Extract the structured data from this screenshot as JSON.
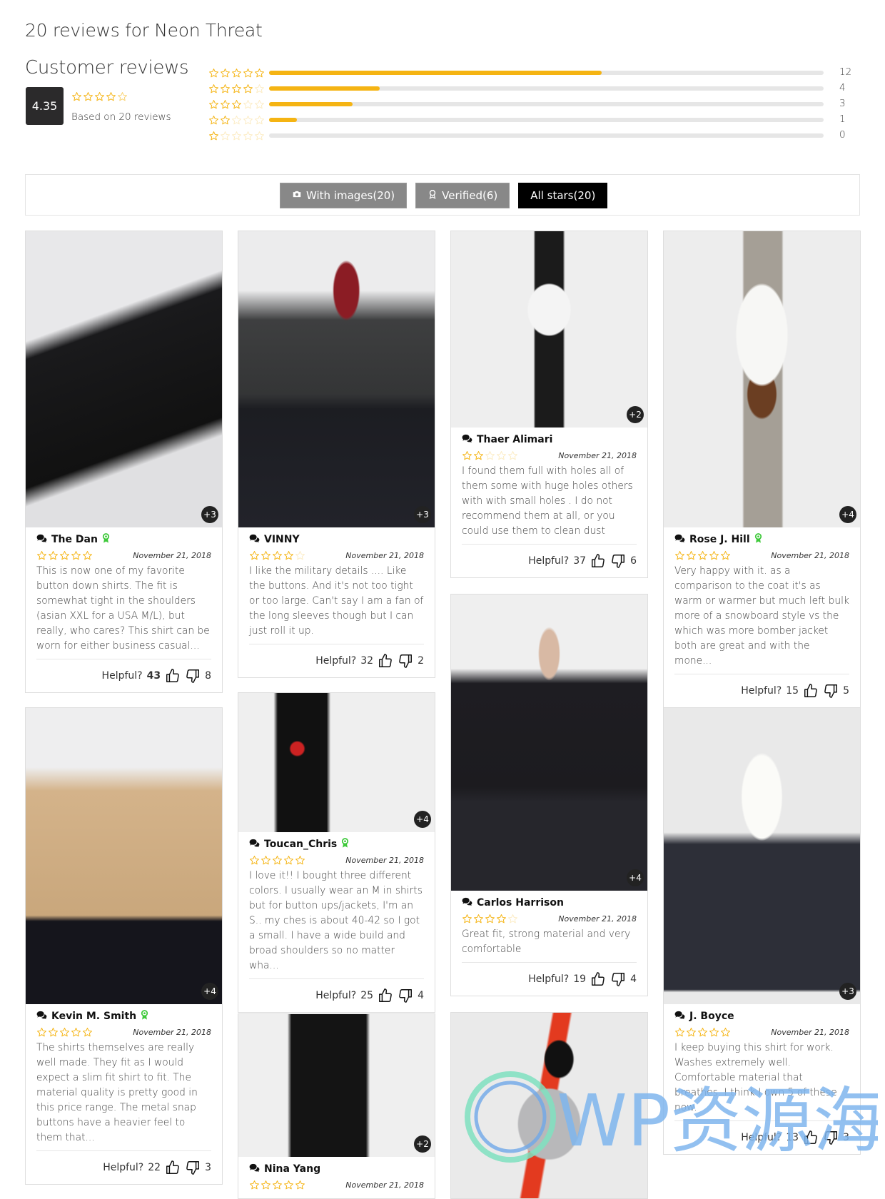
{
  "page": {
    "title": "20 reviews for Neon Threat",
    "customer_reviews_title": "Customer reviews",
    "average": "4.35",
    "average_stars": 4.35,
    "based_on": "Based on 20 reviews",
    "distribution": [
      {
        "stars": 5,
        "count": "12",
        "fraction": 0.6
      },
      {
        "stars": 4,
        "count": "4",
        "fraction": 0.2
      },
      {
        "stars": 3,
        "count": "3",
        "fraction": 0.15
      },
      {
        "stars": 2,
        "count": "1",
        "fraction": 0.05
      },
      {
        "stars": 1,
        "count": "0",
        "fraction": 0
      }
    ]
  },
  "filters": [
    {
      "label": "With images(20)",
      "icon": "camera-icon",
      "active": false
    },
    {
      "label": "Verified(6)",
      "icon": "award-icon",
      "active": false
    },
    {
      "label": "All stars(20)",
      "icon": "",
      "active": true
    }
  ],
  "colors": {
    "star": "#f5b413",
    "verified": "#3ec93a",
    "active_filter": "#000000",
    "filter": "#888888"
  },
  "helpful_label": "Helpful?",
  "reviews": [
    {
      "author": "The Dan",
      "verified": true,
      "rating": 5,
      "date": "November 21, 2018",
      "text": "This is now one of my favorite button down shirts. The fit is somewhat tight in the shoulders (asian XXL for a USA M/L), but really, who cares? This shirt can be worn for either business casual...",
      "up": "43",
      "down": "8",
      "more_images": "+3",
      "up_bold": true
    },
    {
      "author": "VINNY",
      "verified": false,
      "rating": 4,
      "date": "November 21, 2018",
      "text": "I like the military details .... Like the buttons. And it's not too tight or too large. Can't say I am a fan of the long sleeves though but I can just roll it up.",
      "up": "32",
      "down": "2",
      "more_images": "+3"
    },
    {
      "author": "Thaer Alimari",
      "verified": false,
      "rating": 2,
      "date": "November 21, 2018",
      "text": "I found them full with holes all of them some with huge holes others with with small holes . I do not recommend them at all, or you could use them to clean dust",
      "up": "37",
      "down": "6",
      "more_images": "+2"
    },
    {
      "author": "Rose J. Hill",
      "verified": true,
      "rating": 5,
      "date": "November 21, 2018",
      "text": "Very happy with it. as a comparison to the coat it's as warm or warmer but much left bulk more of a snowboard style vs the which was more bomber jacket both are great and with the mone...",
      "up": "15",
      "down": "5",
      "more_images": "+4"
    },
    {
      "author": "Kevin M. Smith",
      "verified": true,
      "rating": 5,
      "date": "November 21, 2018",
      "text": "The shirts themselves are really well made. They fit as I would expect a slim fit shirt to fit. The material quality is pretty good in this price range. The metal snap buttons have a heavier feel to them that...",
      "up": "22",
      "down": "3",
      "more_images": "+4"
    },
    {
      "author": "Toucan_Chris",
      "verified": true,
      "rating": 5,
      "date": "November 21, 2018",
      "text": "I love it!! I bought three different colors. I usually wear an M in shirts but for button ups/jackets, I'm an S.. my ches is about 40-42 so I got a small. I have a wide build and broad shoulders so no matter wha...",
      "up": "25",
      "down": "4",
      "more_images": "+4"
    },
    {
      "author": "Carlos Harrison",
      "verified": false,
      "rating": 4,
      "date": "November 21, 2018",
      "text": "Great fit, strong material and very comfortable",
      "up": "19",
      "down": "4",
      "more_images": "+4"
    },
    {
      "author": "J. Boyce",
      "verified": false,
      "rating": 5,
      "date": "November 21, 2018",
      "text": "I keep buying this shirt for work. Washes extremely well. Comfortable material that breathes. I think I own 5 of these now.",
      "up": "13",
      "down": "3",
      "more_images": "+3"
    },
    {
      "author": "Nina Yang",
      "verified": false,
      "rating": 5,
      "date": "November 21, 2018",
      "text": "",
      "up": "",
      "down": "",
      "more_images": "+2"
    }
  ],
  "watermark": "WP资源海"
}
